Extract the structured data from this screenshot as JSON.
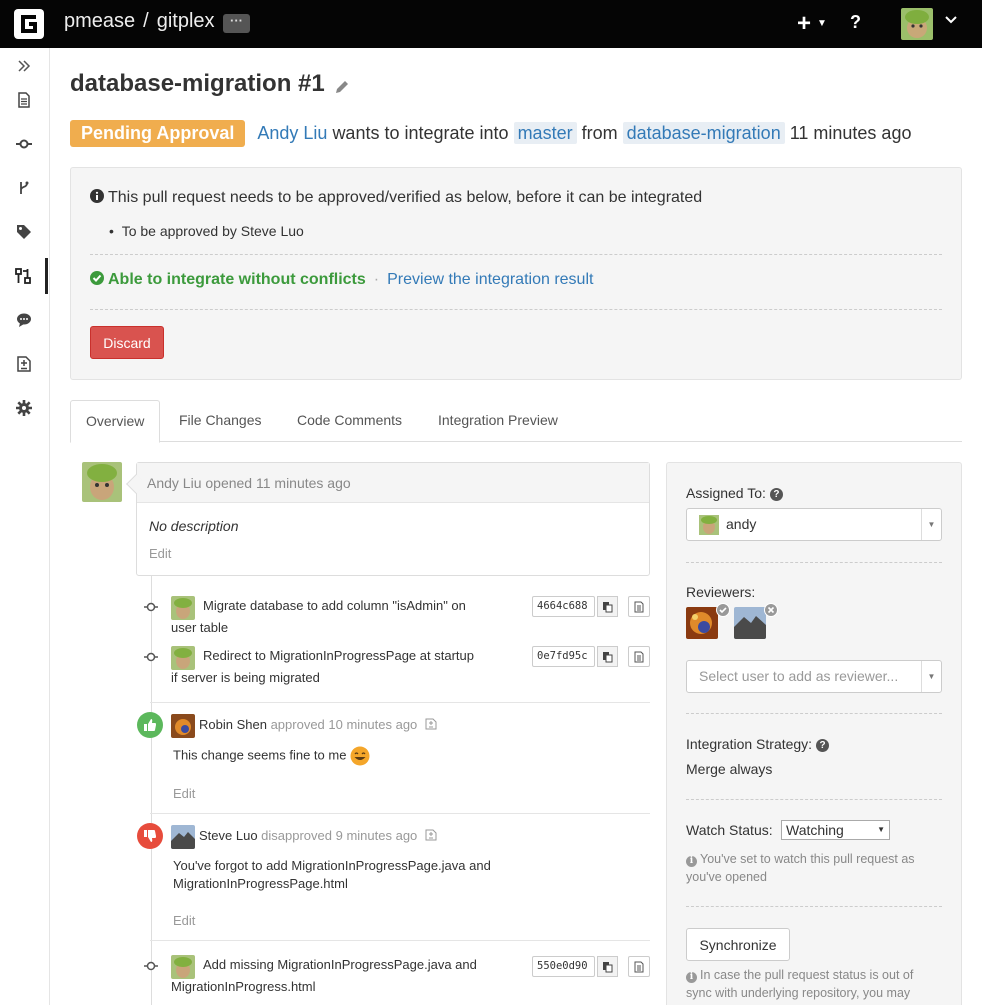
{
  "header": {
    "account": "pmease",
    "separator": "/",
    "repo": "gitplex",
    "more_label": "···",
    "plus_label": "+",
    "help_label": "?"
  },
  "sidebar": {
    "items": [
      {
        "icon": "expand-icon"
      },
      {
        "icon": "file-icon"
      },
      {
        "icon": "commit-icon"
      },
      {
        "icon": "branch-icon"
      },
      {
        "icon": "tag-icon"
      },
      {
        "icon": "pull-request-icon",
        "active": true
      },
      {
        "icon": "comment-icon"
      },
      {
        "icon": "compare-icon"
      },
      {
        "icon": "gear-icon"
      }
    ]
  },
  "pr": {
    "title": "database-migration #1",
    "status_badge": "Pending Approval",
    "author": "Andy Liu",
    "text_integrate": "wants to integrate into",
    "target_branch": "master",
    "text_from": "from",
    "source_branch": "database-migration",
    "age": "11 minutes ago"
  },
  "notice": {
    "message": "This pull request needs to be approved/verified as below, before it can be integrated",
    "requirement": "To be approved by Steve Luo",
    "merge_status": "Able to integrate without conflicts",
    "merge_sep": "·",
    "preview_link": "Preview the integration result",
    "discard_label": "Discard"
  },
  "tabs": [
    {
      "label": "Overview",
      "active": true
    },
    {
      "label": "File Changes"
    },
    {
      "label": "Code Comments"
    },
    {
      "label": "Integration Preview"
    }
  ],
  "activity": {
    "opened": {
      "header": "Andy Liu opened 11 minutes ago",
      "body": "No description",
      "edit": "Edit"
    },
    "commits": [
      {
        "message": "Migrate database to add column \"isAdmin\" on user table",
        "line1": "Migrate database to add column \"isAdmin\" on",
        "line2": "user table",
        "hash": "4664c688"
      },
      {
        "message": "Redirect to MigrationInProgressPage at startup if server is being migrated",
        "line1": "Redirect to MigrationInProgressPage at startup",
        "line2": "if server is being migrated",
        "hash": "0e7fd95c"
      },
      {
        "message": "Add missing MigrationInProgressPage.java and MigrationInProgress.html",
        "line1": "Add missing MigrationInProgressPage.java and",
        "line2": "MigrationInProgress.html",
        "hash": "550e0d90"
      }
    ],
    "approved": {
      "user": "Robin Shen",
      "action": "approved 10 minutes ago",
      "body": "This change seems fine to me",
      "edit": "Edit"
    },
    "disapproved": {
      "user": "Steve Luo",
      "action": "disapproved 9 minutes ago",
      "body_line1": "You've forgot to add MigrationInProgressPage.java and",
      "body_line2": "MigrationInProgressPage.html",
      "edit": "Edit"
    }
  },
  "panel": {
    "assigned_label": "Assigned To:",
    "assignee": "andy",
    "reviewers_label": "Reviewers:",
    "reviewer_placeholder": "Select user to add as reviewer...",
    "strategy_label": "Integration Strategy:",
    "strategy_value": "Merge always",
    "watch_label": "Watch Status:",
    "watch_value": "Watching",
    "watch_info_line1": "You've set to watch this pull request as",
    "watch_info_line2": "you've opened",
    "sync_label": "Synchronize",
    "sync_info_line1": "In case the pull request status is out of",
    "sync_info_line2": "sync with underlying repository, you may"
  },
  "colors": {
    "topbar": "#050505",
    "badge_pending": "#f0ad4e",
    "link": "#337ab7",
    "success": "#3c9a3c",
    "danger": "#d9534f",
    "approve_icon": "#5cb85c",
    "disapprove_icon": "#e74c3c"
  }
}
